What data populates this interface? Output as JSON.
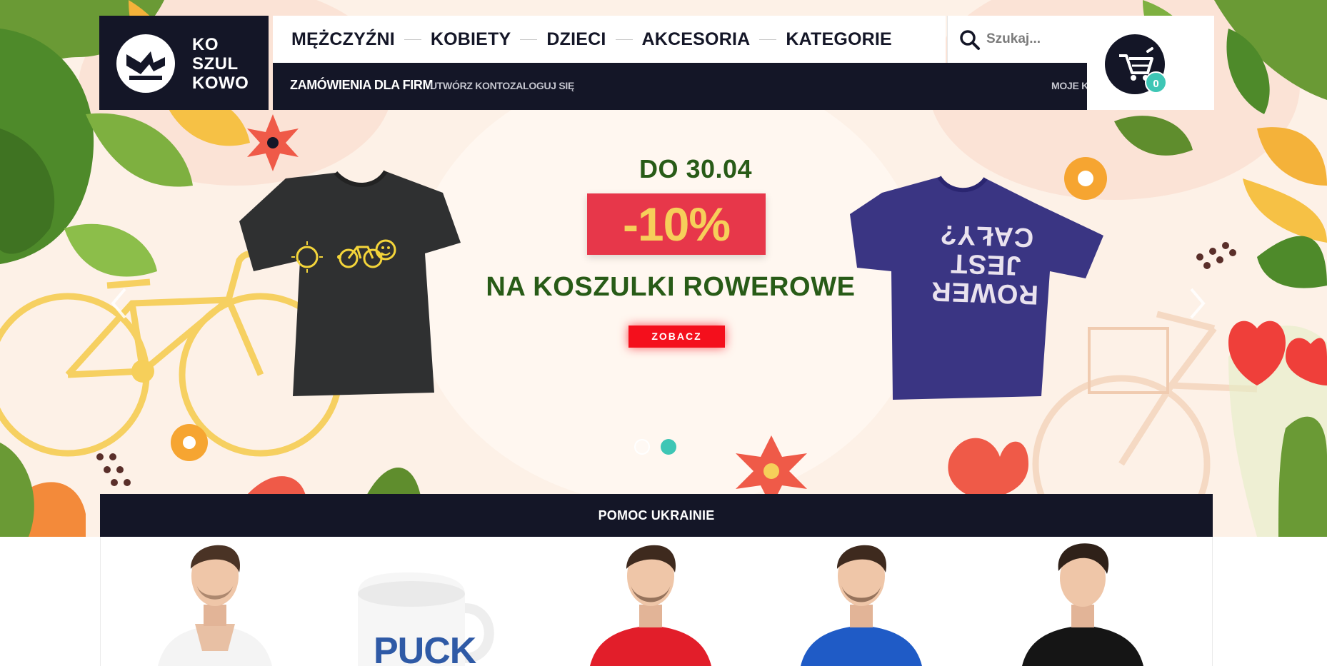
{
  "brand": {
    "logo_lines": [
      "KO",
      "SZUL",
      "KOWO"
    ]
  },
  "nav": {
    "main": [
      "MĘŻCZYŹNI",
      "KOBIETY",
      "DZIECI",
      "AKCESORIA",
      "KATEGORIE"
    ],
    "secondary": {
      "business_orders": "ZAMÓWIENIA DLA FIRM",
      "create_account": "UTWÓRZ KONTO",
      "login": "ZALOGUJ SIĘ",
      "my_account": "MOJE KONTO"
    }
  },
  "search": {
    "placeholder": "Szukaj..."
  },
  "cart": {
    "count": "0"
  },
  "hero": {
    "date": "DO 30.04",
    "discount": "-10%",
    "title": "NA KOSZULKI ROWEROWE",
    "cta": "ZOBACZ",
    "shirt_right_text": [
      "ROWER",
      "JEST",
      "CAŁY?"
    ],
    "slides_total": 2,
    "active_slide": 2
  },
  "banner": {
    "ukraine": "POMOC UKRAINIE"
  },
  "products": {
    "mug_text": "PUCK"
  },
  "colors": {
    "navy": "#141627",
    "teal": "#3ec6b5",
    "promo_red": "#e7374a",
    "promo_yellow": "#f6cf5a",
    "promo_green": "#285b17",
    "cta_red": "#f40f1c",
    "hero_bg": "#fdf1e7"
  }
}
